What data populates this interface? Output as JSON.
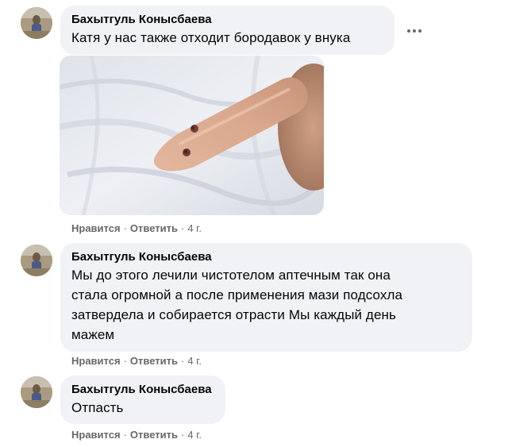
{
  "comments": [
    {
      "author": "Бахытгуль Конысбаева",
      "text": "Катя у нас также отходит бородавок у внука",
      "like_label": "Нравится",
      "reply_label": "Ответить",
      "time": "4 г."
    },
    {
      "author": "Бахытгуль Конысбаева",
      "text_lines": [
        "Мы до этого лечили чистотелом аптечным так она",
        "стала огромной а после применения мази подсохла",
        "затвердела и собирается отрасти Мы каждый день",
        "мажем"
      ],
      "like_label": "Нравится",
      "reply_label": "Ответить",
      "time": "4 г."
    },
    {
      "author": "Бахытгуль Конысбаева",
      "text": "Отпасть",
      "like_label": "Нравится",
      "reply_label": "Ответить",
      "time": "4 г."
    }
  ],
  "separator": "·",
  "icons": {
    "more": "more-options-icon"
  }
}
